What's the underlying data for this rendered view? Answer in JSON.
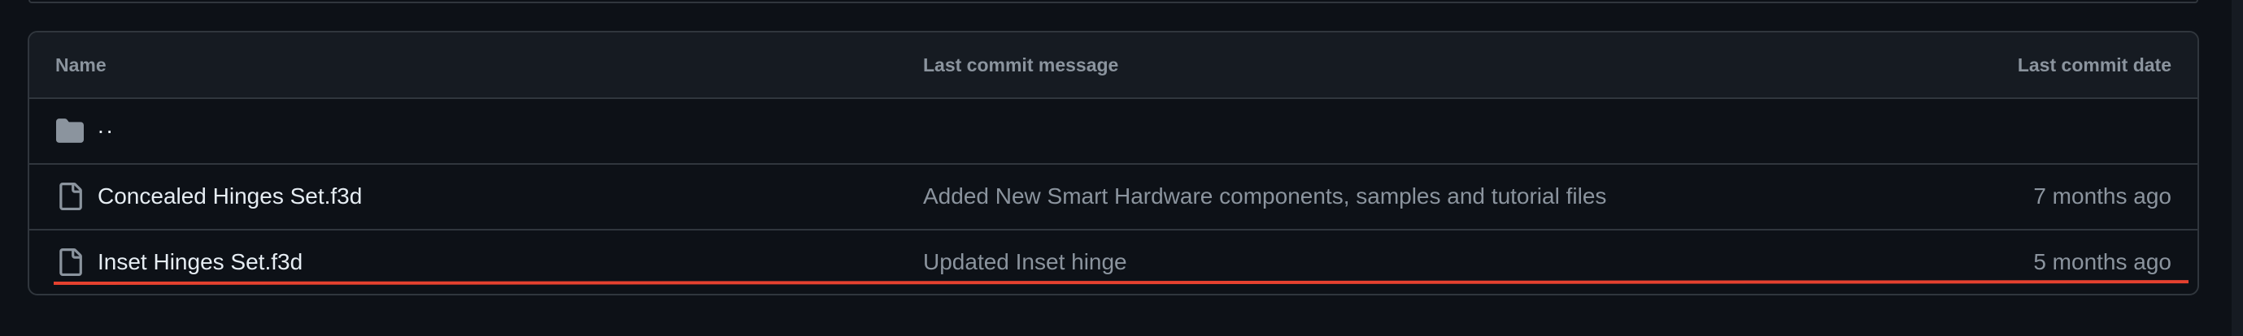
{
  "table": {
    "headers": {
      "name": "Name",
      "message": "Last commit message",
      "date": "Last commit date"
    },
    "parent": {
      "label": "..",
      "icon": "folder-icon"
    },
    "rows": [
      {
        "name": "Concealed Hinges Set.f3d",
        "message": "Added New Smart Hardware components, samples and tutorial files",
        "date": "7 months ago",
        "icon": "file-icon"
      },
      {
        "name": "Inset Hinges Set.f3d",
        "message": "Updated Inset hinge",
        "date": "5 months ago",
        "icon": "file-icon"
      }
    ]
  },
  "colors": {
    "background": "#0d1117",
    "header_background": "#161b22",
    "border": "#30363d",
    "primary_text": "#e6edf3",
    "secondary_text": "#8b949e",
    "annotation_line": "#e5412f"
  }
}
